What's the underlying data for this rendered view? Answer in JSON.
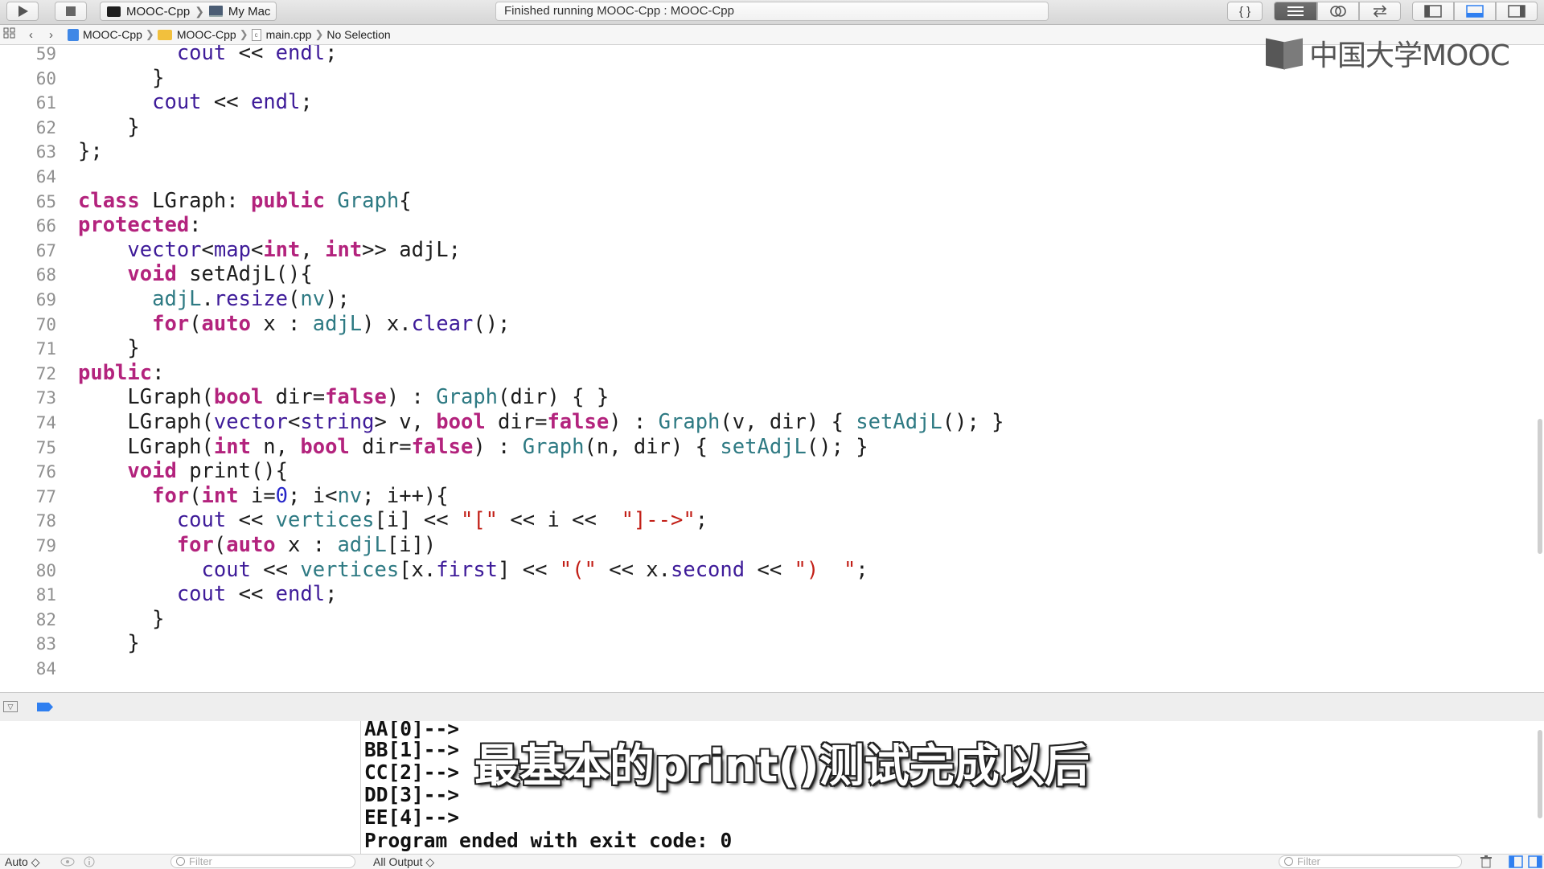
{
  "toolbar": {
    "run_icon": "play-icon",
    "stop_icon": "stop-icon",
    "scheme": "MOOC-Cpp",
    "destination": "My Mac",
    "activity": "Finished running MOOC-Cpp : MOOC-Cpp",
    "braces": "{ }"
  },
  "jumpbar": {
    "crumbs": [
      "MOOC-Cpp",
      "MOOC-Cpp",
      "main.cpp",
      "No Selection"
    ]
  },
  "watermark": "中国大学MOOC",
  "code_lines": [
    {
      "n": "59",
      "html": "        <span class=\"t\">cout</span> &lt;&lt; <span class=\"t\">endl</span>;"
    },
    {
      "n": "60",
      "html": "      }"
    },
    {
      "n": "61",
      "html": "      <span class=\"t\">cout</span> &lt;&lt; <span class=\"t\">endl</span>;"
    },
    {
      "n": "62",
      "html": "    }"
    },
    {
      "n": "63",
      "html": "};"
    },
    {
      "n": "64",
      "html": ""
    },
    {
      "n": "65",
      "html": "<span class=\"k\">class</span> LGraph: <span class=\"k\">public</span> <span class=\"m\">Graph</span>{"
    },
    {
      "n": "66",
      "html": "<span class=\"k\">protected</span>:"
    },
    {
      "n": "67",
      "html": "    <span class=\"t\">vector</span>&lt;<span class=\"t\">map</span>&lt;<span class=\"k\">int</span>, <span class=\"k\">int</span>&gt;&gt; adjL;"
    },
    {
      "n": "68",
      "html": "    <span class=\"k\">void</span> setAdjL(){"
    },
    {
      "n": "69",
      "html": "      <span class=\"m\">adjL</span>.<span class=\"t\">resize</span>(<span class=\"m\">nv</span>);"
    },
    {
      "n": "70",
      "html": "      <span class=\"k\">for</span>(<span class=\"k\">auto</span> x : <span class=\"m\">adjL</span>) x.<span class=\"t\">clear</span>();"
    },
    {
      "n": "71",
      "html": "    }"
    },
    {
      "n": "72",
      "html": "<span class=\"k\">public</span>:"
    },
    {
      "n": "73",
      "html": "    LGraph(<span class=\"k\">bool</span> dir=<span class=\"k\">false</span>) : <span class=\"m\">Graph</span>(dir) { }"
    },
    {
      "n": "74",
      "html": "    LGraph(<span class=\"t\">vector</span>&lt;<span class=\"t\">string</span>&gt; v, <span class=\"k\">bool</span> dir=<span class=\"k\">false</span>) : <span class=\"m\">Graph</span>(v, dir) { <span class=\"m\">setAdjL</span>(); }"
    },
    {
      "n": "75",
      "html": "    LGraph(<span class=\"k\">int</span> n, <span class=\"k\">bool</span> dir=<span class=\"k\">false</span>) : <span class=\"m\">Graph</span>(n, dir) { <span class=\"m\">setAdjL</span>(); }"
    },
    {
      "n": "76",
      "html": "    <span class=\"k\">void</span> print(){"
    },
    {
      "n": "77",
      "html": "      <span class=\"k\">for</span>(<span class=\"k\">int</span> i=<span class=\"n\">0</span>; i&lt;<span class=\"m\">nv</span>; i++){"
    },
    {
      "n": "78",
      "html": "        <span class=\"t\">cout</span> &lt;&lt; <span class=\"m\">vertices</span>[i] &lt;&lt; <span class=\"s\">\"[\"</span> &lt;&lt; i &lt;&lt;  <span class=\"s\">\"]--&gt;\"</span>;"
    },
    {
      "n": "79",
      "html": "        <span class=\"k\">for</span>(<span class=\"k\">auto</span> x : <span class=\"m\">adjL</span>[i])"
    },
    {
      "n": "80",
      "html": "          <span class=\"t\">cout</span> &lt;&lt; <span class=\"m\">vertices</span>[x.<span class=\"t\">first</span>] &lt;&lt; <span class=\"s\">\"(\"</span> &lt;&lt; x.<span class=\"t\">second</span> &lt;&lt; <span class=\"s\">\")  \"</span>;"
    },
    {
      "n": "81",
      "html": "        <span class=\"t\">cout</span> &lt;&lt; <span class=\"t\">endl</span>;"
    },
    {
      "n": "82",
      "html": "      }"
    },
    {
      "n": "83",
      "html": "    }"
    },
    {
      "n": "84",
      "html": ""
    }
  ],
  "console": {
    "lines": [
      "AA[0]-->",
      "BB[1]-->",
      "CC[2]-->",
      "DD[3]-->",
      "EE[4]-->",
      "Program ended with exit code: 0"
    ],
    "subtitle": "最基本的print()测试完成以后"
  },
  "bottom": {
    "auto_label": "Auto ◇",
    "filter_placeholder": "Filter",
    "output_label": "All Output ◇"
  }
}
